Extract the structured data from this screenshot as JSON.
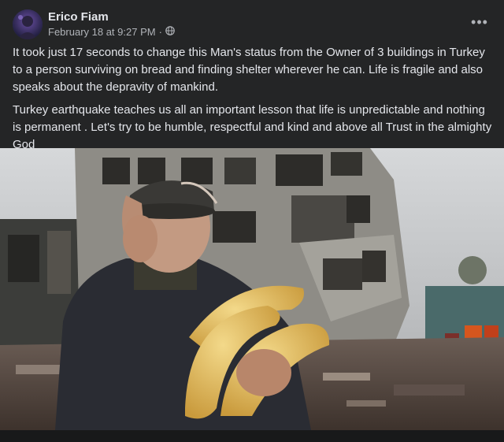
{
  "post": {
    "author": "Erico Fiam",
    "timestamp": "February 18 at 9:27 PM",
    "separator": "·",
    "privacy_icon": "globe-icon",
    "more_icon": "more-options-icon",
    "paragraphs": [
      "It took just 17 seconds to change this Man's status from the Owner of 3 buildings in Turkey to a person surviving on bread and finding shelter wherever he can. Life is fragile and also speaks about the depravity of mankind.",
      "Turkey earthquake teaches us all an important lesson that life is unpredictable and nothing is permanent . Let's try to be humble, respectful and kind and above all Trust in the almighty God"
    ],
    "emoji": "🙏"
  },
  "colors": {
    "background": "#242526",
    "text": "#e4e6eb",
    "secondary_text": "#b0b3b8"
  }
}
